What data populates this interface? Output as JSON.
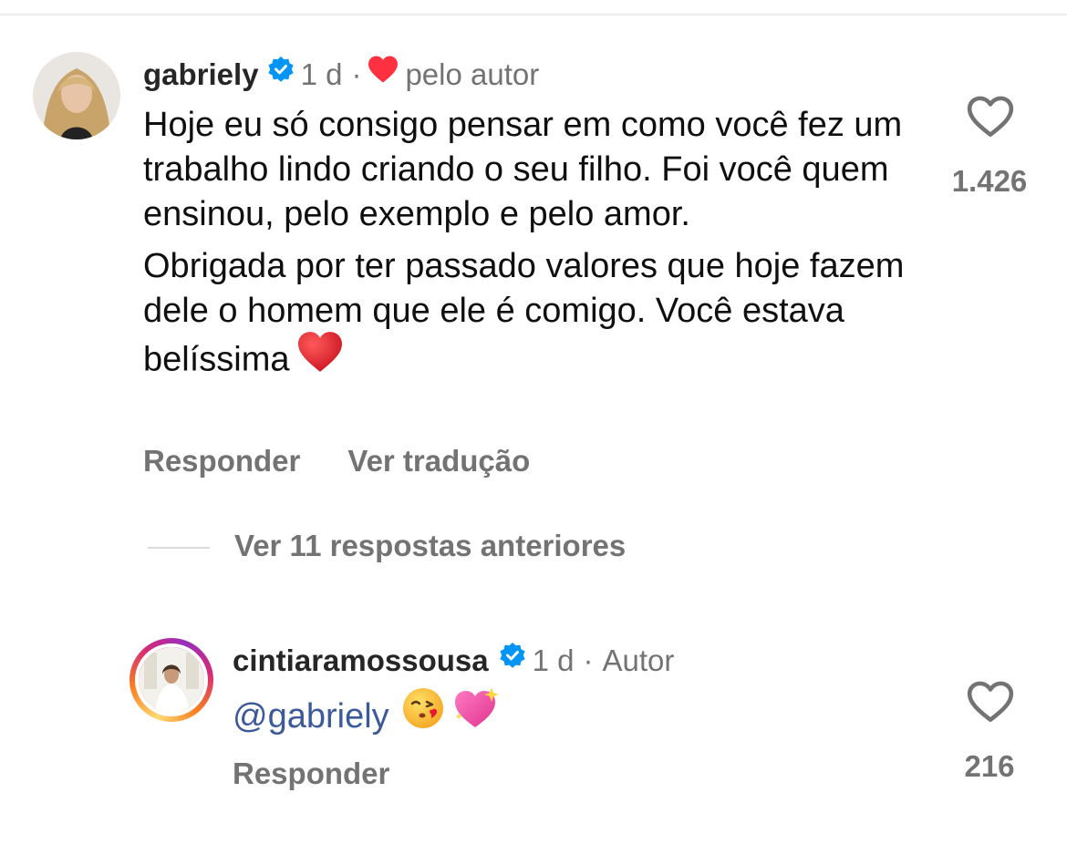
{
  "comments": [
    {
      "username": "gabriely",
      "time": "1 d",
      "separator": "·",
      "author_like_label": "pelo autor",
      "paragraphs": [
        "Hoje eu só consigo pensar em como você fez um trabalho lindo criando o seu filho. Foi você quem ensinou, pelo exemplo e pelo amor.",
        "Obrigada por ter passado valores que hoje fazem dele o homem que ele é comigo. Você estava belíssima"
      ],
      "trailing_emoji": "red-heart",
      "reply_label": "Responder",
      "translate_label": "Ver tradução",
      "like_count": "1.426"
    },
    {
      "username": "cintiaramossousa",
      "time": "1 d",
      "separator": "·",
      "author_label": "Autor",
      "mention": "@gabriely",
      "emojis": [
        "face-blowing-kiss",
        "sparkling-heart"
      ],
      "reply_label": "Responder",
      "like_count": "216"
    }
  ],
  "replies_toggle": "Ver 11 respostas anteriores",
  "colors": {
    "verified": "#0095f6",
    "heart": "#ff3040",
    "muted_text": "#737373",
    "mention": "#3c5a9a"
  }
}
